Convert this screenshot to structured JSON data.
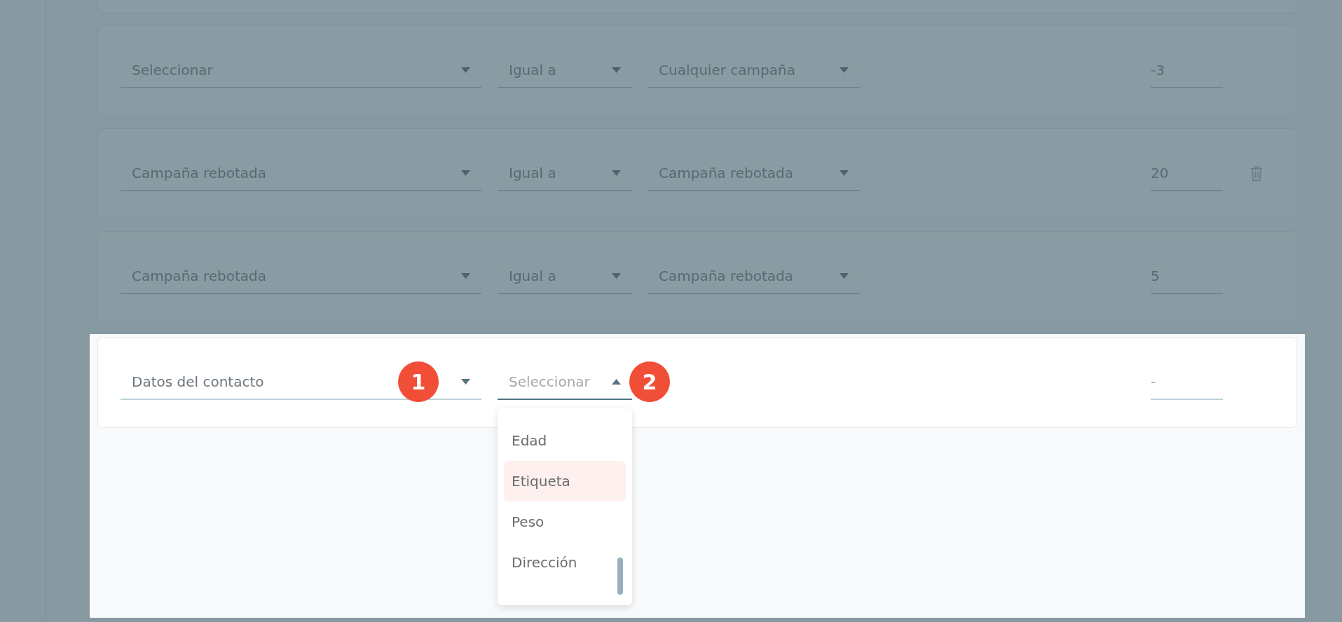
{
  "rows": [
    {
      "field": "Seleccionar",
      "operator": "Igual a",
      "value": "Cualquier campaña",
      "score": "-3",
      "deletable": false
    },
    {
      "field": "Campaña rebotada",
      "operator": "Igual a",
      "value": "Campaña rebotada",
      "score": "20",
      "deletable": true
    },
    {
      "field": "Campaña rebotada",
      "operator": "Igual a",
      "value": "Campaña rebotada",
      "score": "5",
      "deletable": false
    }
  ],
  "active_row": {
    "field": "Datos del contacto",
    "operator": {
      "placeholder": "Seleccionar",
      "focused": true,
      "expanded": true,
      "options": [
        {
          "label": "Edad",
          "selected": false
        },
        {
          "label": "Etiqueta",
          "selected": true
        },
        {
          "label": "Peso",
          "selected": false
        },
        {
          "label": "Dirección",
          "selected": false
        }
      ]
    },
    "score": {
      "placeholder": "-"
    }
  },
  "callouts": [
    {
      "number": "1"
    },
    {
      "number": "2"
    }
  ]
}
